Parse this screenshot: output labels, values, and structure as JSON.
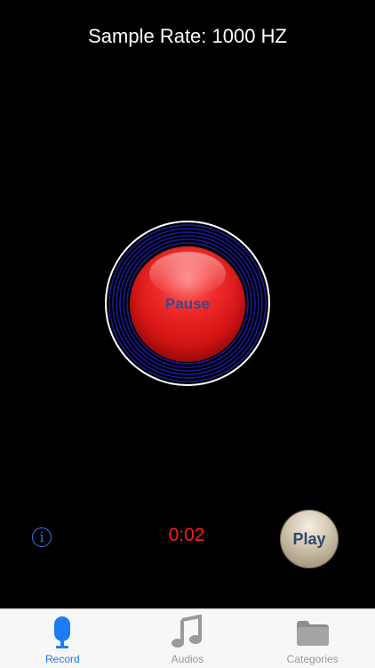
{
  "header": {
    "sample_rate": "Sample Rate: 1000 HZ"
  },
  "recorder": {
    "pause_label": "Pause",
    "timer": "0:02",
    "play_label": "Play"
  },
  "tab_bar": {
    "tabs": [
      {
        "label": "Record",
        "icon": "microphone-icon",
        "active": true
      },
      {
        "label": "Audios",
        "icon": "music-note-icon",
        "active": false
      },
      {
        "label": "Categories",
        "icon": "folder-icon",
        "active": false
      }
    ]
  },
  "colors": {
    "background": "#000000",
    "record_button": "#e01f1f",
    "timer": "#ff1a1a",
    "accent": "#1d7cf2",
    "ring": "#1a1aa0"
  }
}
